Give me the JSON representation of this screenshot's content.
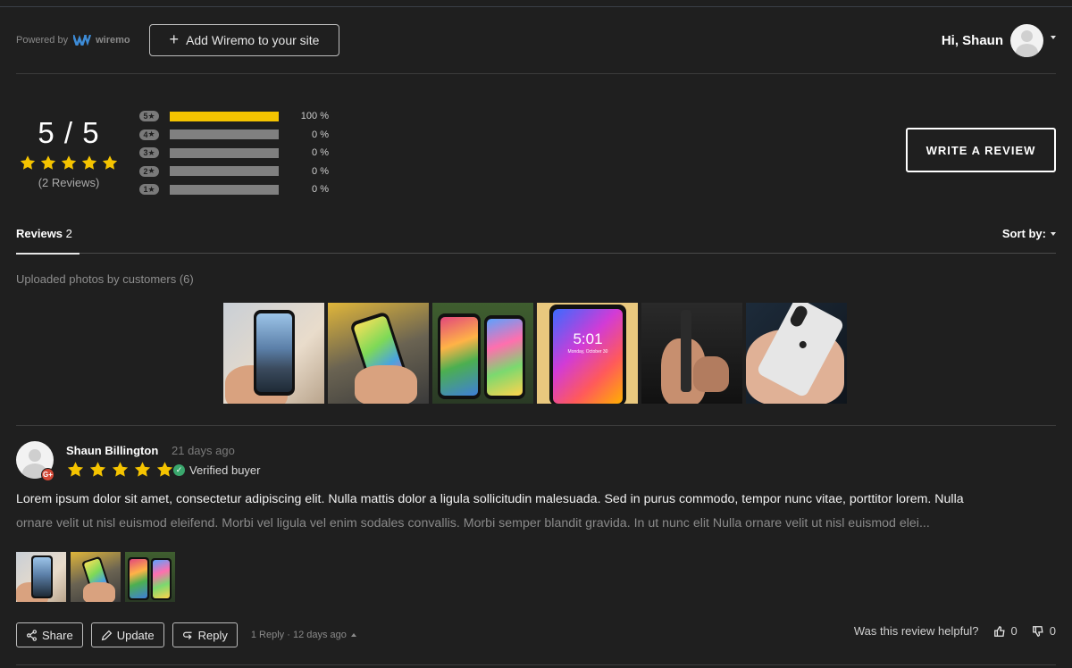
{
  "header": {
    "powered_by": "Powered by",
    "brand": "wiremo",
    "add_button": "Add Wiremo to your site",
    "greeting": "Hi, Shaun"
  },
  "summary": {
    "score": "5 / 5",
    "count": "(2 Reviews)",
    "rating": 5,
    "bars": [
      {
        "label": "5",
        "pct": "100 %",
        "fill": 1.0
      },
      {
        "label": "4",
        "pct": "0 %",
        "fill": 0
      },
      {
        "label": "3",
        "pct": "0 %",
        "fill": 0
      },
      {
        "label": "2",
        "pct": "0 %",
        "fill": 0
      },
      {
        "label": "1",
        "pct": "0 %",
        "fill": 0
      }
    ],
    "write_button": "WRITE A REVIEW"
  },
  "tabs": {
    "reviews_label": "Reviews",
    "reviews_count": "2",
    "sort_label": "Sort by:"
  },
  "gallery": {
    "title": "Uploaded photos by customers (6)",
    "lockscreen_time": "5:01",
    "lockscreen_date": "Monday, October 30"
  },
  "review": {
    "author": "Shaun Billington",
    "time": "21 days ago",
    "rating": 5,
    "verified": "Verified buyer",
    "text_line1": "Lorem ipsum dolor sit amet, consectetur adipiscing elit. Nulla mattis dolor a ligula sollicitudin malesuada. Sed in purus commodo, tempor nunc vitae, porttitor lorem. Nulla",
    "text_line2": "ornare velit ut nisl euismod eleifend. Morbi vel ligula vel enim sodales convallis. Morbi semper blandit gravida. In ut nunc elit Nulla ornare velit ut nisl euismod elei...",
    "share": "Share",
    "update": "Update",
    "reply": "Reply",
    "reply_meta": "1 Reply · 12 days ago",
    "helpful_question": "Was this review helpful?",
    "up_count": "0",
    "down_count": "0"
  },
  "colors": {
    "background": "#1f1f1f",
    "star": "#f5c400",
    "verified": "#3aa76d",
    "google_badge": "#d34836"
  }
}
